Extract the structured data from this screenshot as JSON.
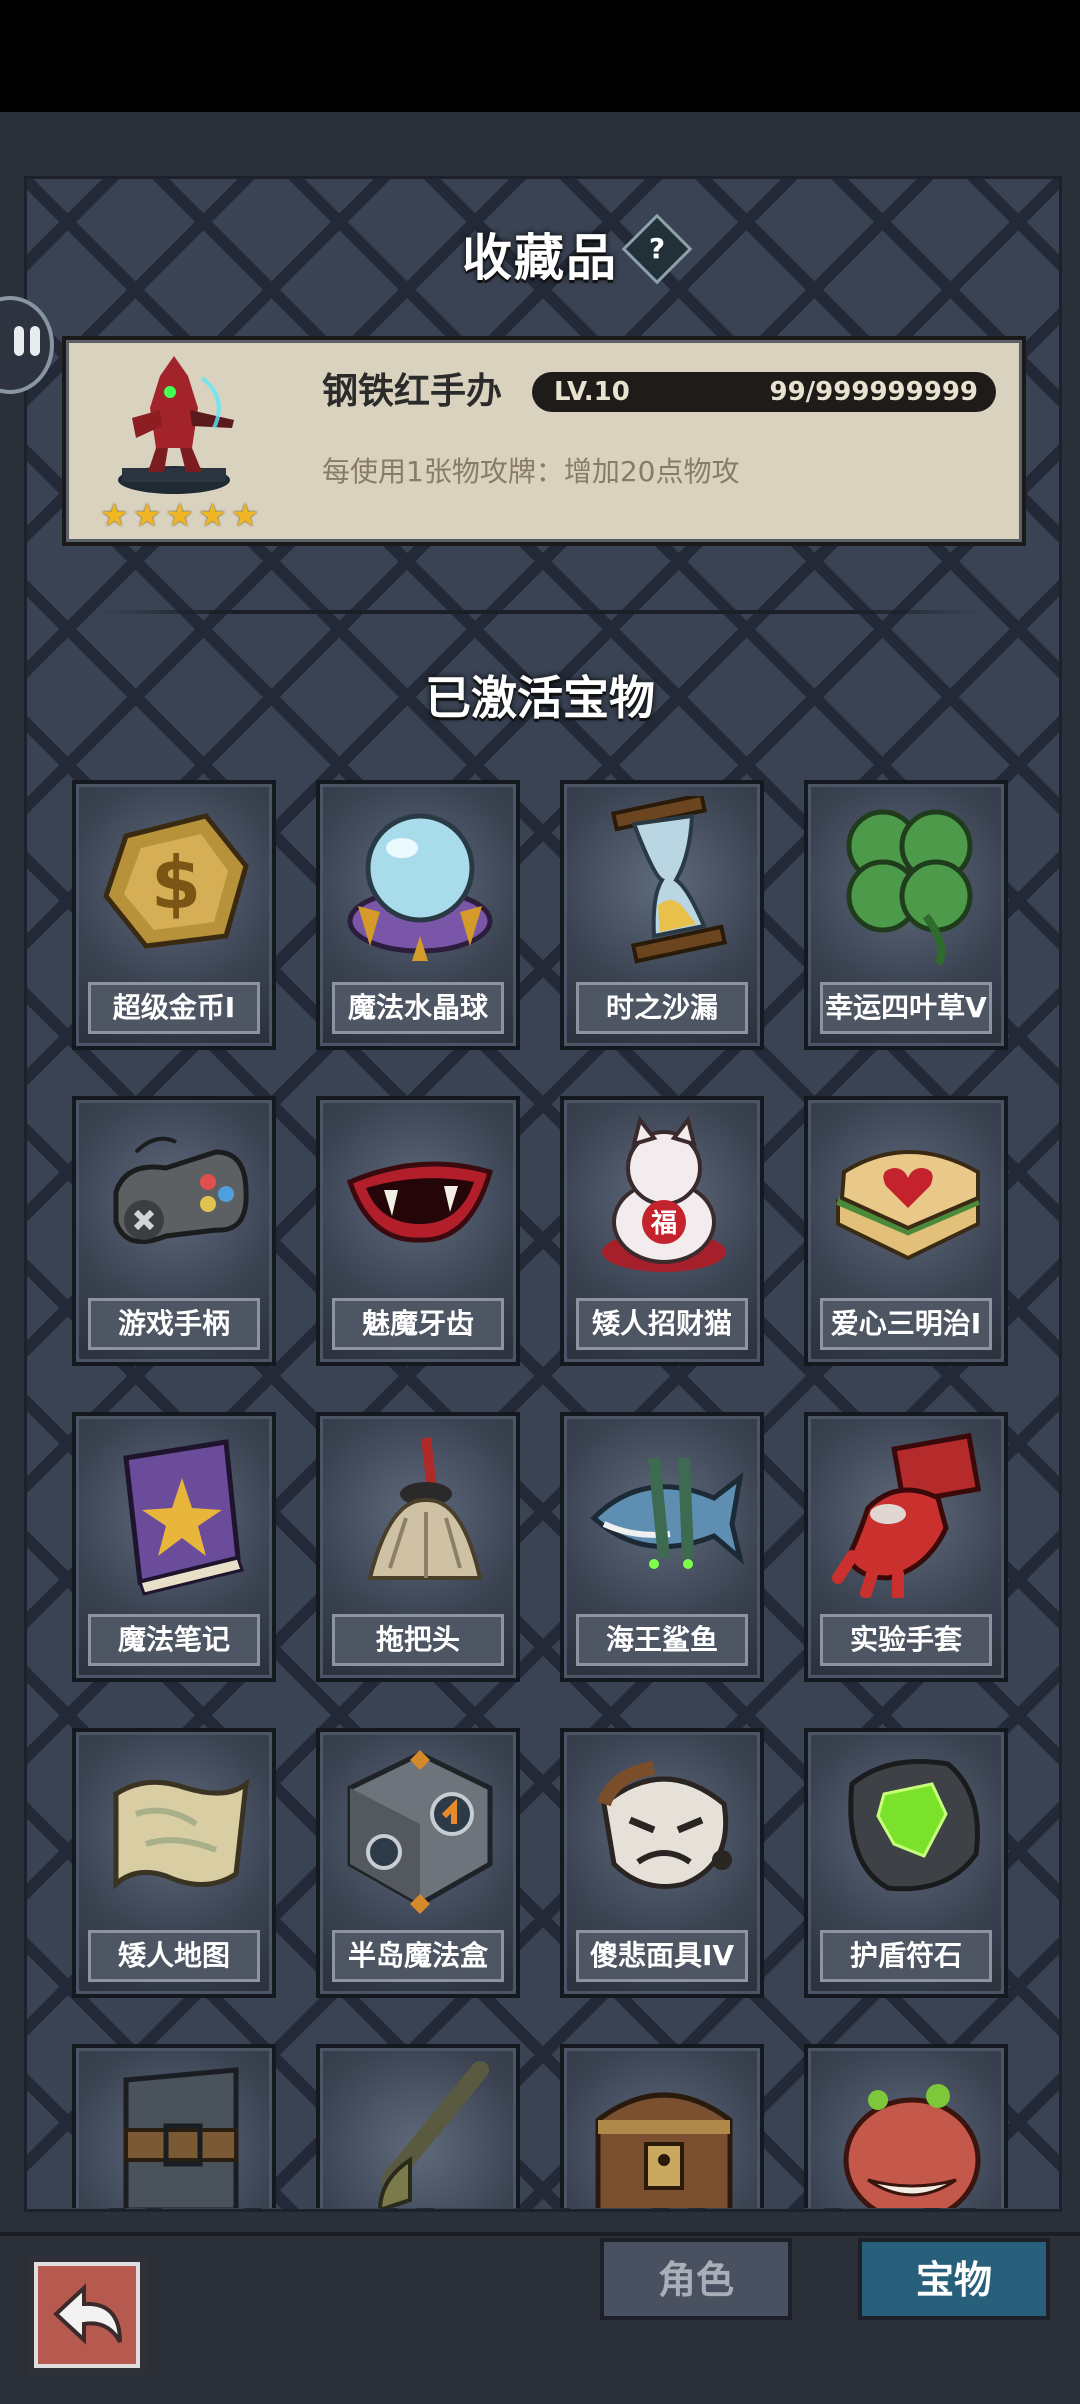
{
  "header": {
    "title": "收藏品",
    "help_glyph": "?"
  },
  "featured": {
    "name": "钢铁红手办",
    "level": "LV.10",
    "count": "99/999999999",
    "description": "每使用1张物攻牌：增加20点物攻",
    "stars": 5,
    "star_glyph": "★"
  },
  "section": {
    "title": "已激活宝物"
  },
  "treasures": [
    {
      "label": "超级金币I",
      "icon": "gold-coin-icon"
    },
    {
      "label": "魔法水晶球",
      "icon": "crystal-ball-icon"
    },
    {
      "label": "时之沙漏",
      "icon": "hourglass-icon"
    },
    {
      "label": "幸运四叶草V",
      "icon": "four-leaf-clover-icon"
    },
    {
      "label": "游戏手柄",
      "icon": "gamepad-icon"
    },
    {
      "label": "魅魔牙齿",
      "icon": "fangs-icon"
    },
    {
      "label": "矮人招财猫",
      "icon": "lucky-cat-icon"
    },
    {
      "label": "爱心三明治I",
      "icon": "heart-sandwich-icon"
    },
    {
      "label": "魔法笔记",
      "icon": "spellbook-icon"
    },
    {
      "label": "拖把头",
      "icon": "mop-head-icon"
    },
    {
      "label": "海王鲨鱼",
      "icon": "shark-icon"
    },
    {
      "label": "实验手套",
      "icon": "red-glove-icon"
    },
    {
      "label": "矮人地图",
      "icon": "map-scroll-icon"
    },
    {
      "label": "半岛魔法盒",
      "icon": "magic-cube-icon"
    },
    {
      "label": "傻悲面具IV",
      "icon": "sad-mask-icon"
    },
    {
      "label": "护盾符石",
      "icon": "rune-stone-icon"
    },
    {
      "label": "",
      "icon": "armor-belt-icon"
    },
    {
      "label": "",
      "icon": "club-icon"
    },
    {
      "label": "",
      "icon": "treasure-chest-icon"
    },
    {
      "label": "",
      "icon": "mushroom-monster-icon"
    }
  ],
  "bottom_nav": {
    "back_icon": "back-arrow-icon",
    "tabs": [
      {
        "label": "角色",
        "active": false
      },
      {
        "label": "宝物",
        "active": true
      }
    ]
  },
  "colors": {
    "panel": "#3a4354",
    "card": "#d9d2bf",
    "active_tab": "#285f7a",
    "star": "#f0b623"
  }
}
